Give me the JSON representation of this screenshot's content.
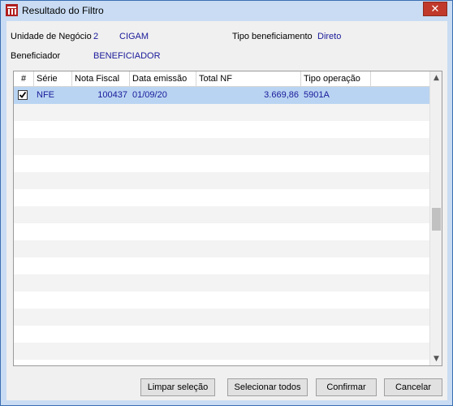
{
  "window": {
    "title": "Resultado do Filtro"
  },
  "filters": {
    "unidade_label": "Unidade de Negócio",
    "unidade_code": "2",
    "unidade_name": "CIGAM",
    "tipo_label": "Tipo beneficiamento",
    "tipo_value": "Direto",
    "beneficiador_label": "Beneficiador",
    "beneficiador_value": "BENEFICIADOR"
  },
  "table": {
    "columns": [
      "#",
      "Série",
      "Nota Fiscal",
      "Data emissão",
      "Total NF",
      "Tipo operação"
    ],
    "rows": [
      {
        "checked": true,
        "serie": "NFE",
        "nota_fiscal": "100437",
        "data_emissao": "01/09/20",
        "total_nf": "3.669,86",
        "tipo_operacao": "5901A"
      }
    ]
  },
  "buttons": {
    "limpar": "Limpar seleção",
    "selecionar": "Selecionar todos",
    "confirmar": "Confirmar",
    "cancelar": "Cancelar"
  },
  "icons": {
    "app": "app-logo-icon",
    "close": "close-icon",
    "check": "checkbox-checked-icon"
  },
  "colors": {
    "title_bar": "#c9dcf3",
    "value_text": "#1a1a9a",
    "selected_row": "#b9d4f2",
    "close_button": "#c0392b"
  }
}
